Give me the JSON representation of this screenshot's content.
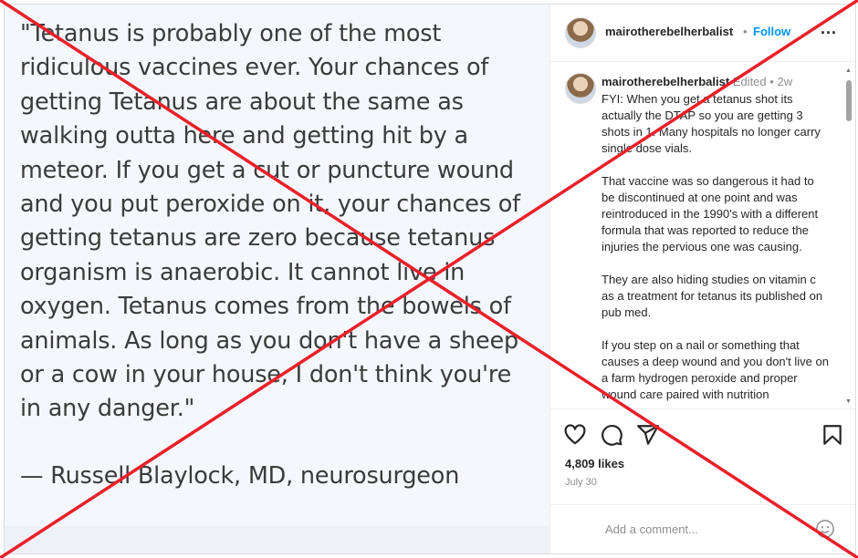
{
  "post_image": {
    "quote": "\"Tetanus is probably one of the most\nridiculous vaccines ever. Your chances of\ngetting Tetanus are about the same as\nwalking outta here and getting hit by a\nmeteor. If you get a cut or puncture wound\nand you put peroxide on it, your chances of\ngetting tetanus are zero because tetanus\norganism is anaerobic. It cannot live in\noxygen. Tetanus comes from the bowels of\nanimals. As long as you don't have a sheep\nor a cow in your house, I don't think you're\nin any danger.\"",
    "attribution": "— Russell Blaylock, MD, neurosurgeon"
  },
  "header": {
    "username": "mairotherebelherbalist",
    "separator": "•",
    "follow_label": "Follow",
    "more_icon": "more-horizontal-icon",
    "more_glyph": "..."
  },
  "comment": {
    "username": "mairotherebelherbalist",
    "edited": "Edited",
    "separator": "•",
    "age": "2w",
    "body": "FYI: When you get a tetanus shot its actually the DTAP so you are getting 3 shots in 1. Many hospitals no longer carry single dose vials.\n\nThat vaccine was so dangerous it had to be discontinued at one point and was reintroduced in the 1990's with a different formula that was reported to reduce the injuries the pervious one was causing.\n\nThey are also hiding studies on vitamin c as a treatment for tetanus its published on pub med.\n\nIf you step on a nail or something that causes a deep wound and you don't live on a farm hydrogen peroxide and proper wound care paired with nutrition"
  },
  "actions": {
    "icons": [
      "heart-icon",
      "comment-bubble-icon",
      "share-paper-plane-icon",
      "bookmark-icon"
    ],
    "likes": "4,809 likes",
    "date": "July 30"
  },
  "add_comment": {
    "placeholder": "Add a comment...",
    "emoji_icon": "emoji-smile-icon"
  },
  "colors": {
    "accent_follow": "#0095f6",
    "overlay_x": "#e8202a",
    "text_primary": "#262626",
    "text_secondary": "#8e8e8e"
  }
}
